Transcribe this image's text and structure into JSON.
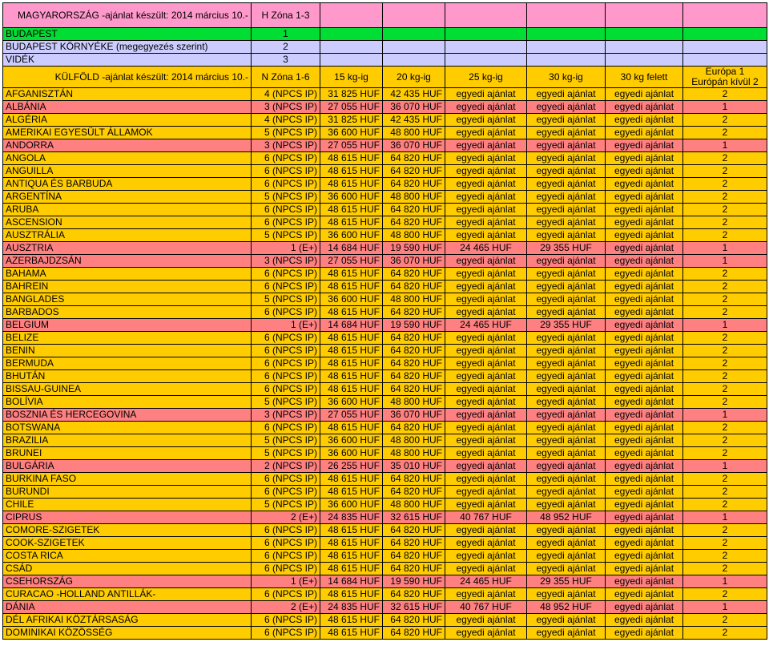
{
  "top": {
    "title": "MAGYARORSZÁG -ajánlat készült: 2014 március 10.-",
    "zone": "H Zóna 1-3"
  },
  "domestic": [
    {
      "label": "BUDAPEST",
      "zone": "1"
    },
    {
      "label": "BUDAPEST KÖRNYÉKE (megegyezés szerint)",
      "zone": "2"
    },
    {
      "label": "VIDÉK",
      "zone": "3"
    }
  ],
  "header": {
    "title": "KÜLFÖLD -ajánlat készült: 2014 március 10.-",
    "zone": "N Zóna 1-6",
    "w15": "15 kg-ig",
    "w20": "20 kg-ig",
    "w25": "25 kg-ig",
    "w30": "30 kg-ig",
    "over30": "30 kg felett",
    "eu_line1": "Európa 1",
    "eu_line2": "Európán kívül 2"
  },
  "colors": {
    "pink": "#ff99cc",
    "green": "#00dd33",
    "lavender": "#ccccff",
    "yellow": "#ffcc00",
    "salmon": "#ff8080"
  },
  "countries": [
    {
      "name": "AFGANISZTÁN",
      "zone": "4 (NPCS IP)",
      "w15": "31 825 HUF",
      "w20": "42 435 HUF",
      "w25": "egyedi ajánlat",
      "w30": "egyedi ajánlat",
      "over30": "egyedi ajánlat",
      "eu": "2"
    },
    {
      "name": "ALBÁNIA",
      "zone": "3 (NPCS IP)",
      "w15": "27 055 HUF",
      "w20": "36 070 HUF",
      "w25": "egyedi ajánlat",
      "w30": "egyedi ajánlat",
      "over30": "egyedi ajánlat",
      "eu": "1"
    },
    {
      "name": "ALGÉRIA",
      "zone": "4 (NPCS IP)",
      "w15": "31 825 HUF",
      "w20": "42 435 HUF",
      "w25": "egyedi ajánlat",
      "w30": "egyedi ajánlat",
      "over30": "egyedi ajánlat",
      "eu": "2"
    },
    {
      "name": "AMERIKAI EGYESÜLT ÁLLAMOK",
      "zone": "5 (NPCS IP)",
      "w15": "36 600 HUF",
      "w20": "48 800 HUF",
      "w25": "egyedi ajánlat",
      "w30": "egyedi ajánlat",
      "over30": "egyedi ajánlat",
      "eu": "2"
    },
    {
      "name": "ANDORRA",
      "zone": "3 (NPCS IP)",
      "w15": "27 055 HUF",
      "w20": "36 070 HUF",
      "w25": "egyedi ajánlat",
      "w30": "egyedi ajánlat",
      "over30": "egyedi ajánlat",
      "eu": "1"
    },
    {
      "name": "ANGOLA",
      "zone": "6 (NPCS IP)",
      "w15": "48 615 HUF",
      "w20": "64 820 HUF",
      "w25": "egyedi ajánlat",
      "w30": "egyedi ajánlat",
      "over30": "egyedi ajánlat",
      "eu": "2"
    },
    {
      "name": "ANGUILLA",
      "zone": "6 (NPCS IP)",
      "w15": "48 615 HUF",
      "w20": "64 820 HUF",
      "w25": "egyedi ajánlat",
      "w30": "egyedi ajánlat",
      "over30": "egyedi ajánlat",
      "eu": "2"
    },
    {
      "name": "ANTIQUA ÉS BARBUDA",
      "zone": "6 (NPCS IP)",
      "w15": "48 615 HUF",
      "w20": "64 820 HUF",
      "w25": "egyedi ajánlat",
      "w30": "egyedi ajánlat",
      "over30": "egyedi ajánlat",
      "eu": "2"
    },
    {
      "name": "ARGENTÍNA",
      "zone": "5 (NPCS IP)",
      "w15": "36 600 HUF",
      "w20": "48 800 HUF",
      "w25": "egyedi ajánlat",
      "w30": "egyedi ajánlat",
      "over30": "egyedi ajánlat",
      "eu": "2"
    },
    {
      "name": "ARUBA",
      "zone": "6 (NPCS IP)",
      "w15": "48 615 HUF",
      "w20": "64 820 HUF",
      "w25": "egyedi ajánlat",
      "w30": "egyedi ajánlat",
      "over30": "egyedi ajánlat",
      "eu": "2"
    },
    {
      "name": "ASCENSION",
      "zone": "6 (NPCS IP)",
      "w15": "48 615 HUF",
      "w20": "64 820 HUF",
      "w25": "egyedi ajánlat",
      "w30": "egyedi ajánlat",
      "over30": "egyedi ajánlat",
      "eu": "2"
    },
    {
      "name": "AUSZTRÁLIA",
      "zone": "5 (NPCS IP)",
      "w15": "36 600 HUF",
      "w20": "48 800 HUF",
      "w25": "egyedi ajánlat",
      "w30": "egyedi ajánlat",
      "over30": "egyedi ajánlat",
      "eu": "2"
    },
    {
      "name": "AUSZTRIA",
      "zone": "1 (E+)",
      "w15": "14 684 HUF",
      "w20": "19 590 HUF",
      "w25": "24 465 HUF",
      "w30": "29 355 HUF",
      "over30": "egyedi ajánlat",
      "eu": "1"
    },
    {
      "name": "AZERBAJDZSÁN",
      "zone": "3 (NPCS IP)",
      "w15": "27 055 HUF",
      "w20": "36 070 HUF",
      "w25": "egyedi ajánlat",
      "w30": "egyedi ajánlat",
      "over30": "egyedi ajánlat",
      "eu": "1"
    },
    {
      "name": "BAHAMA",
      "zone": "6 (NPCS IP)",
      "w15": "48 615 HUF",
      "w20": "64 820 HUF",
      "w25": "egyedi ajánlat",
      "w30": "egyedi ajánlat",
      "over30": "egyedi ajánlat",
      "eu": "2"
    },
    {
      "name": "BAHREIN",
      "zone": "6 (NPCS IP)",
      "w15": "48 615 HUF",
      "w20": "64 820 HUF",
      "w25": "egyedi ajánlat",
      "w30": "egyedi ajánlat",
      "over30": "egyedi ajánlat",
      "eu": "2"
    },
    {
      "name": "BANGLADES",
      "zone": "5 (NPCS IP)",
      "w15": "36 600 HUF",
      "w20": "48 800 HUF",
      "w25": "egyedi ajánlat",
      "w30": "egyedi ajánlat",
      "over30": "egyedi ajánlat",
      "eu": "2"
    },
    {
      "name": "BARBADOS",
      "zone": "6 (NPCS IP)",
      "w15": "48 615 HUF",
      "w20": "64 820 HUF",
      "w25": "egyedi ajánlat",
      "w30": "egyedi ajánlat",
      "over30": "egyedi ajánlat",
      "eu": "2"
    },
    {
      "name": "BELGIUM",
      "zone": "1 (E+)",
      "w15": "14 684 HUF",
      "w20": "19 590 HUF",
      "w25": "24 465 HUF",
      "w30": "29 355 HUF",
      "over30": "egyedi ajánlat",
      "eu": "1"
    },
    {
      "name": "BELIZE",
      "zone": "6 (NPCS IP)",
      "w15": "48 615 HUF",
      "w20": "64 820 HUF",
      "w25": "egyedi ajánlat",
      "w30": "egyedi ajánlat",
      "over30": "egyedi ajánlat",
      "eu": "2"
    },
    {
      "name": "BENIN",
      "zone": "6 (NPCS IP)",
      "w15": "48 615 HUF",
      "w20": "64 820 HUF",
      "w25": "egyedi ajánlat",
      "w30": "egyedi ajánlat",
      "over30": "egyedi ajánlat",
      "eu": "2"
    },
    {
      "name": "BERMUDA",
      "zone": "6 (NPCS IP)",
      "w15": "48 615 HUF",
      "w20": "64 820 HUF",
      "w25": "egyedi ajánlat",
      "w30": "egyedi ajánlat",
      "over30": "egyedi ajánlat",
      "eu": "2"
    },
    {
      "name": "BHUTÁN",
      "zone": "6 (NPCS IP)",
      "w15": "48 615 HUF",
      "w20": "64 820 HUF",
      "w25": "egyedi ajánlat",
      "w30": "egyedi ajánlat",
      "over30": "egyedi ajánlat",
      "eu": "2"
    },
    {
      "name": "BISSAU-GUINEA",
      "zone": "6 (NPCS IP)",
      "w15": "48 615 HUF",
      "w20": "64 820 HUF",
      "w25": "egyedi ajánlat",
      "w30": "egyedi ajánlat",
      "over30": "egyedi ajánlat",
      "eu": "2"
    },
    {
      "name": "BOLÍVIA",
      "zone": "5 (NPCS IP)",
      "w15": "36 600 HUF",
      "w20": "48 800 HUF",
      "w25": "egyedi ajánlat",
      "w30": "egyedi ajánlat",
      "over30": "egyedi ajánlat",
      "eu": "2"
    },
    {
      "name": "BOSZNIA ÉS HERCEGOVINA",
      "zone": "3 (NPCS IP)",
      "w15": "27 055 HUF",
      "w20": "36 070 HUF",
      "w25": "egyedi ajánlat",
      "w30": "egyedi ajánlat",
      "over30": "egyedi ajánlat",
      "eu": "1"
    },
    {
      "name": "BOTSWANA",
      "zone": "6 (NPCS IP)",
      "w15": "48 615 HUF",
      "w20": "64 820 HUF",
      "w25": "egyedi ajánlat",
      "w30": "egyedi ajánlat",
      "over30": "egyedi ajánlat",
      "eu": "2"
    },
    {
      "name": "BRAZILIA",
      "zone": "5 (NPCS IP)",
      "w15": "36 600 HUF",
      "w20": "48 800 HUF",
      "w25": "egyedi ajánlat",
      "w30": "egyedi ajánlat",
      "over30": "egyedi ajánlat",
      "eu": "2"
    },
    {
      "name": "BRUNEI",
      "zone": "5 (NPCS IP)",
      "w15": "36 600 HUF",
      "w20": "48 800 HUF",
      "w25": "egyedi ajánlat",
      "w30": "egyedi ajánlat",
      "over30": "egyedi ajánlat",
      "eu": "2"
    },
    {
      "name": "BULGÁRIA",
      "zone": "2 (NPCS IP)",
      "w15": "26 255 HUF",
      "w20": "35 010 HUF",
      "w25": "egyedi ajánlat",
      "w30": "egyedi ajánlat",
      "over30": "egyedi ajánlat",
      "eu": "1"
    },
    {
      "name": "BURKINA FASO",
      "zone": "6 (NPCS IP)",
      "w15": "48 615 HUF",
      "w20": "64 820 HUF",
      "w25": "egyedi ajánlat",
      "w30": "egyedi ajánlat",
      "over30": "egyedi ajánlat",
      "eu": "2"
    },
    {
      "name": "BURUNDI",
      "zone": "6 (NPCS IP)",
      "w15": "48 615 HUF",
      "w20": "64 820 HUF",
      "w25": "egyedi ajánlat",
      "w30": "egyedi ajánlat",
      "over30": "egyedi ajánlat",
      "eu": "2"
    },
    {
      "name": "CHILE",
      "zone": "5 (NPCS IP)",
      "w15": "36 600 HUF",
      "w20": "48 800 HUF",
      "w25": "egyedi ajánlat",
      "w30": "egyedi ajánlat",
      "over30": "egyedi ajánlat",
      "eu": "2"
    },
    {
      "name": "CIPRUS",
      "zone": "2 (E+)",
      "w15": "24 835 HUF",
      "w20": "32 615 HUF",
      "w25": "40 767 HUF",
      "w30": "48 952 HUF",
      "over30": "egyedi ajánlat",
      "eu": "1"
    },
    {
      "name": "COMORE-SZIGETEK",
      "zone": "6 (NPCS IP)",
      "w15": "48 615 HUF",
      "w20": "64 820 HUF",
      "w25": "egyedi ajánlat",
      "w30": "egyedi ajánlat",
      "over30": "egyedi ajánlat",
      "eu": "2"
    },
    {
      "name": "COOK-SZIGETEK",
      "zone": "6 (NPCS IP)",
      "w15": "48 615 HUF",
      "w20": "64 820 HUF",
      "w25": "egyedi ajánlat",
      "w30": "egyedi ajánlat",
      "over30": "egyedi ajánlat",
      "eu": "2"
    },
    {
      "name": "COSTA RICA",
      "zone": "6 (NPCS IP)",
      "w15": "48 615 HUF",
      "w20": "64 820 HUF",
      "w25": "egyedi ajánlat",
      "w30": "egyedi ajánlat",
      "over30": "egyedi ajánlat",
      "eu": "2"
    },
    {
      "name": "CSÁD",
      "zone": "6 (NPCS IP)",
      "w15": "48 615 HUF",
      "w20": "64 820 HUF",
      "w25": "egyedi ajánlat",
      "w30": "egyedi ajánlat",
      "over30": "egyedi ajánlat",
      "eu": "2"
    },
    {
      "name": "CSEHORSZÁG",
      "zone": "1 (E+)",
      "w15": "14 684 HUF",
      "w20": "19 590 HUF",
      "w25": "24 465 HUF",
      "w30": "29 355 HUF",
      "over30": "egyedi ajánlat",
      "eu": "1"
    },
    {
      "name": "CURACAO -HOLLAND ANTILLÁK-",
      "zone": "6 (NPCS IP)",
      "w15": "48 615 HUF",
      "w20": "64 820 HUF",
      "w25": "egyedi ajánlat",
      "w30": "egyedi ajánlat",
      "over30": "egyedi ajánlat",
      "eu": "2"
    },
    {
      "name": "DÁNIA",
      "zone": "2 (E+)",
      "w15": "24 835 HUF",
      "w20": "32 615 HUF",
      "w25": "40 767 HUF",
      "w30": "48 952 HUF",
      "over30": "egyedi ajánlat",
      "eu": "1"
    },
    {
      "name": "DÉL AFRIKAI KÖZTÁRSASÁG",
      "zone": "6 (NPCS IP)",
      "w15": "48 615 HUF",
      "w20": "64 820 HUF",
      "w25": "egyedi ajánlat",
      "w30": "egyedi ajánlat",
      "over30": "egyedi ajánlat",
      "eu": "2"
    },
    {
      "name": "DOMINIKAI KÖZÖSSÉG",
      "zone": "6 (NPCS IP)",
      "w15": "48 615 HUF",
      "w20": "64 820 HUF",
      "w25": "egyedi ajánlat",
      "w30": "egyedi ajánlat",
      "over30": "egyedi ajánlat",
      "eu": "2"
    }
  ]
}
